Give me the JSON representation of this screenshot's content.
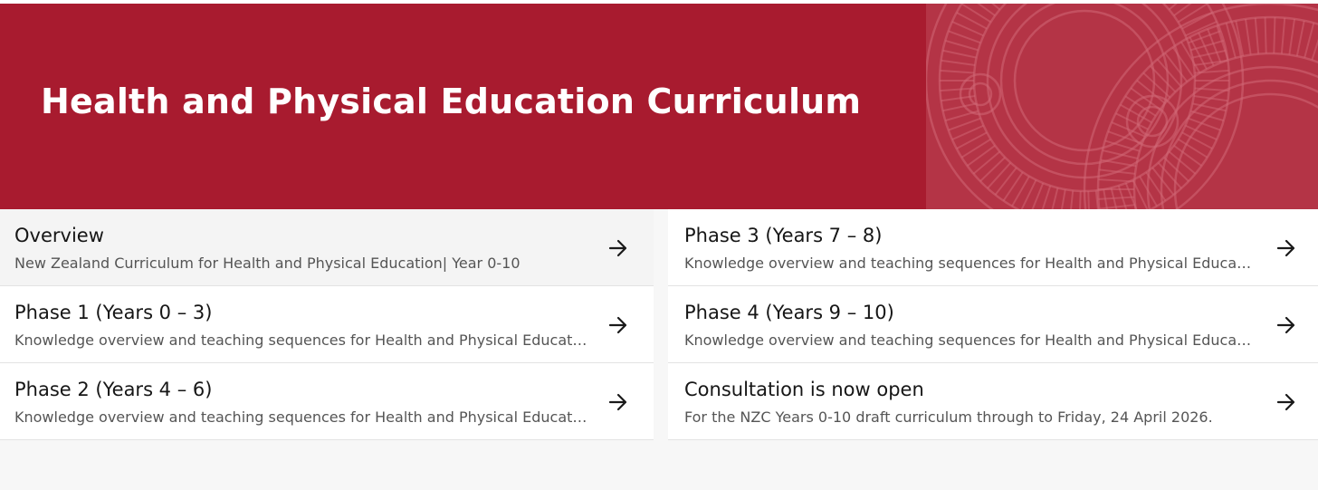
{
  "banner": {
    "title": "Health and Physical Education Curriculum",
    "background_color": "#a81b2f",
    "pattern_color": "#b43446"
  },
  "cards": [
    {
      "title": "Overview",
      "description": "New Zealand Curriculum for Health and Physical Education| Year 0-10",
      "icon": "arrow-right-icon"
    },
    {
      "title": "Phase 1 (Years 0 – 3)",
      "description": "Knowledge overview and teaching sequences for Health and Physical Education",
      "icon": "arrow-right-icon"
    },
    {
      "title": "Phase 2 (Years 4 – 6)",
      "description": "Knowledge overview and teaching sequences for Health and Physical Education",
      "icon": "arrow-right-icon"
    },
    {
      "title": "Phase 3 (Years 7 – 8)",
      "description": "Knowledge overview and teaching sequences for Health and Physical Education",
      "icon": "arrow-right-icon"
    },
    {
      "title": "Phase 4 (Years 9 – 10)",
      "description": "Knowledge overview and teaching sequences for Health and Physical Education",
      "icon": "arrow-right-icon"
    },
    {
      "title": "Consultation is now open",
      "description": "For the NZC Years 0-10 draft curriculum through to Friday, 24 April 2026.",
      "icon": "arrow-right-icon"
    }
  ]
}
